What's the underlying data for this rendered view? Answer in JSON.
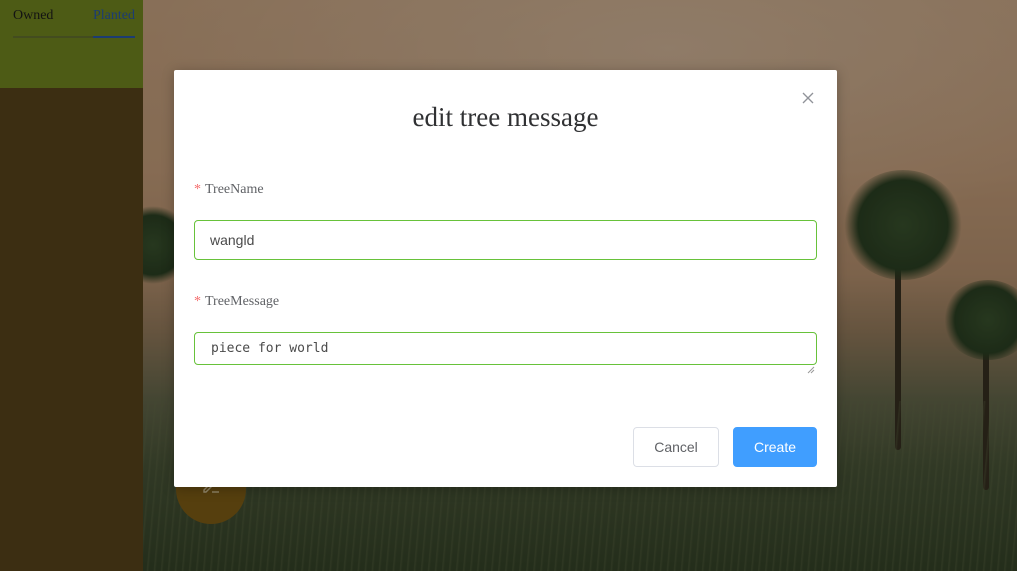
{
  "sidebar": {
    "tabs": [
      {
        "label": "Owned"
      },
      {
        "label": "Planted"
      }
    ],
    "active_tab": "Planted"
  },
  "background": {
    "fab_icon": "edit-icon"
  },
  "dialog": {
    "title": "edit tree message",
    "close_icon": "close-icon",
    "fields": {
      "tree_name": {
        "label": "TreeName",
        "required_mark": "*",
        "value": "wangld"
      },
      "tree_message": {
        "label": "TreeMessage",
        "required_mark": "*",
        "value": "piece for world"
      }
    },
    "buttons": {
      "cancel": "Cancel",
      "create": "Create"
    }
  },
  "colors": {
    "sidebar_top": "#7d9322",
    "sidebar": "#614b1d",
    "active_tab": "#2e62b8",
    "input_border_valid": "#67c23a",
    "required": "#f56c6c",
    "primary_button": "#409eff"
  }
}
